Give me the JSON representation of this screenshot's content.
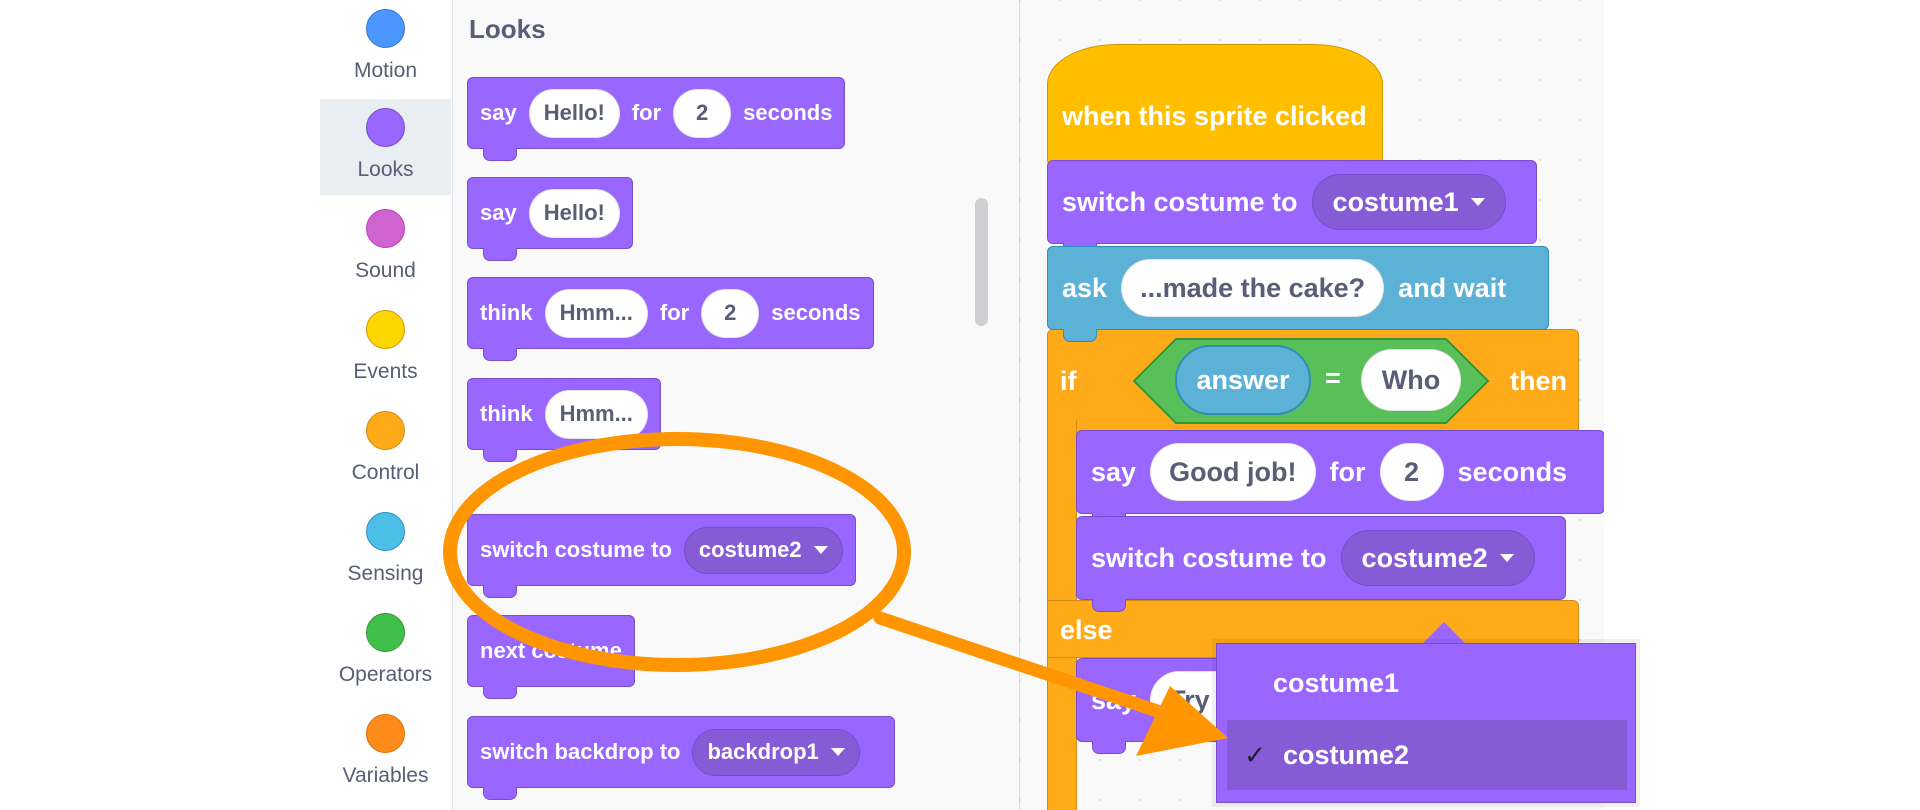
{
  "categories": [
    {
      "label": "Motion",
      "color": "#4c97ff",
      "border": "#3373cc"
    },
    {
      "label": "Looks",
      "color": "#9966ff",
      "border": "#774dcb",
      "selected": true
    },
    {
      "label": "Sound",
      "color": "#cf63cf",
      "border": "#bd42bd"
    },
    {
      "label": "Events",
      "color": "#ffd500",
      "border": "#cc9900"
    },
    {
      "label": "Control",
      "color": "#ffab19",
      "border": "#cf8b17"
    },
    {
      "label": "Sensing",
      "color": "#4cbfe6",
      "border": "#2e8eb8"
    },
    {
      "label": "Operators",
      "color": "#40bf4a",
      "border": "#389438"
    },
    {
      "label": "Variables",
      "color": "#ff8c1a",
      "border": "#db6e00"
    }
  ],
  "palette": {
    "title": "Looks",
    "say_for": {
      "say": "say",
      "msg": "Hello!",
      "for": "for",
      "secs": "2",
      "seconds": "seconds"
    },
    "say": {
      "say": "say",
      "msg": "Hello!"
    },
    "think_for": {
      "think": "think",
      "msg": "Hmm...",
      "for": "for",
      "secs": "2",
      "seconds": "seconds"
    },
    "think": {
      "think": "think",
      "msg": "Hmm..."
    },
    "switch_costume": {
      "text": "switch costume to",
      "value": "costume2"
    },
    "next_costume": {
      "text": "next costume"
    },
    "switch_backdrop": {
      "text": "switch backdrop to",
      "value": "backdrop1"
    }
  },
  "script": {
    "hat": "when this sprite clicked",
    "switch1": {
      "text": "switch costume to",
      "value": "costume1"
    },
    "ask": {
      "ask": "ask",
      "question": "...made the cake?",
      "and_wait": "and wait"
    },
    "if": "if",
    "answer": "answer",
    "equals": "=",
    "who": "Who",
    "then": "then",
    "say_for": {
      "say": "say",
      "msg": "Good job!",
      "for": "for",
      "secs": "2",
      "seconds": "seconds"
    },
    "switch2": {
      "text": "switch costume to",
      "value": "costume2"
    },
    "else": "else",
    "else_say": {
      "say": "say",
      "msg": "Try a"
    }
  },
  "dropdown": {
    "options": [
      {
        "label": "costume1",
        "checked": false
      },
      {
        "label": "costume2",
        "checked": true
      }
    ],
    "check_mark": "✓"
  },
  "colors": {
    "looks": "#9966ff",
    "control": "#ffab19",
    "events": "#ffbf00",
    "sensing": "#5cb1d6",
    "operators": "#59c059",
    "annotation": "#ff9500"
  }
}
